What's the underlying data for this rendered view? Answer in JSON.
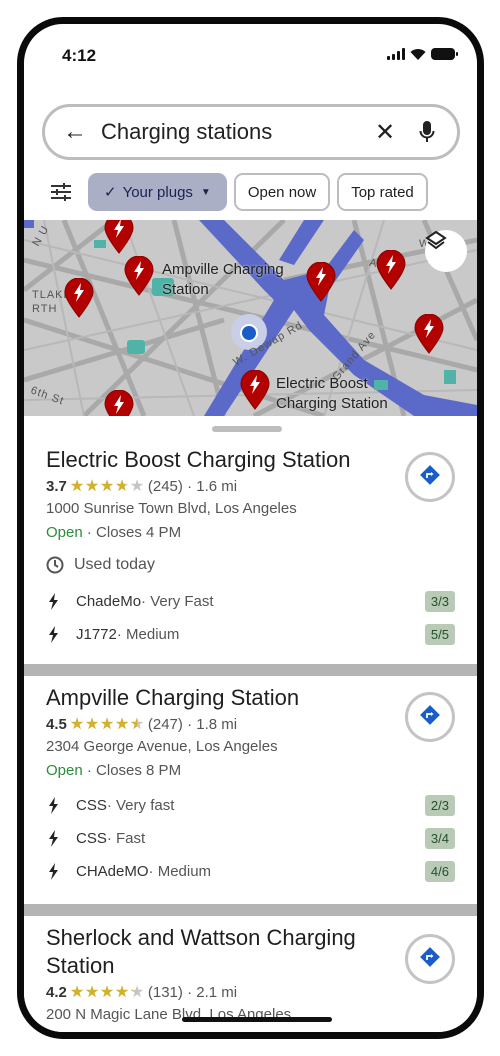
{
  "status_bar": {
    "time": "4:12"
  },
  "search": {
    "query": "Charging stations",
    "back_icon": "arrow-left-icon",
    "clear_icon": "close-icon",
    "mic_icon": "mic-icon"
  },
  "filters": {
    "filter_icon": "tune-icon",
    "chips": [
      {
        "label": "Your plugs",
        "selected": true,
        "has_dropdown": true
      },
      {
        "label": "Open now",
        "selected": false
      },
      {
        "label": "Top rated",
        "selected": false
      }
    ]
  },
  "map": {
    "labels": {
      "ampville": "Ampville Charging Station",
      "electric_boost": "Electric Boost Charging Station"
    },
    "streets": {
      "westlake": "TLAKE\nRTH",
      "sixth": "6th St",
      "dewap": "W. Dewap Rd",
      "grand": "Grand Ave",
      "alpine": "Alpine",
      "wc": "W C",
      "nu": "N U"
    },
    "layers_icon": "layers-icon",
    "accent_pin": "#b30000",
    "road_major": "#5b69c9"
  },
  "results": [
    {
      "name": "Electric Boost Charging Station",
      "rating": "3.7",
      "rating_value": 3.7,
      "reviews": "(245)",
      "distance": "· 1.6 mi",
      "address": "1000 Sunrise Town Blvd, Los Angeles",
      "open": "Open",
      "hours": " · Closes 4 PM",
      "used": "Used today",
      "plugs": [
        {
          "type": "ChadeMo",
          "speed": " · Very Fast",
          "availability": "3/3"
        },
        {
          "type": "J1772",
          "speed": " · Medium",
          "availability": "5/5"
        }
      ]
    },
    {
      "name": "Ampville Charging Station",
      "rating": "4.5",
      "rating_value": 4.5,
      "reviews": "(247)",
      "distance": "· 1.8 mi",
      "address": "2304 George Avenue, Los Angeles",
      "open": "Open",
      "hours": " · Closes 8 PM",
      "plugs": [
        {
          "type": "CSS",
          "speed": " · Very fast",
          "availability": "2/3"
        },
        {
          "type": "CSS",
          "speed": " · Fast",
          "availability": "3/4"
        },
        {
          "type": "CHAdeMO",
          "speed": " · Medium",
          "availability": "4/6"
        }
      ]
    },
    {
      "name": "Sherlock and Wattson Charging Station",
      "rating": "4.2",
      "rating_value": 4.2,
      "reviews": "(131)",
      "distance": "· 2.1 mi",
      "address": "200 N Magic Lane Blvd, Los Angeles"
    }
  ],
  "colors": {
    "open_green": "#2e8b3a",
    "star_gold": "#d4b12a",
    "directions_blue": "#1a5cc8",
    "badge_bg": "#b9cbb7",
    "chip_selected": "#abafc6"
  }
}
